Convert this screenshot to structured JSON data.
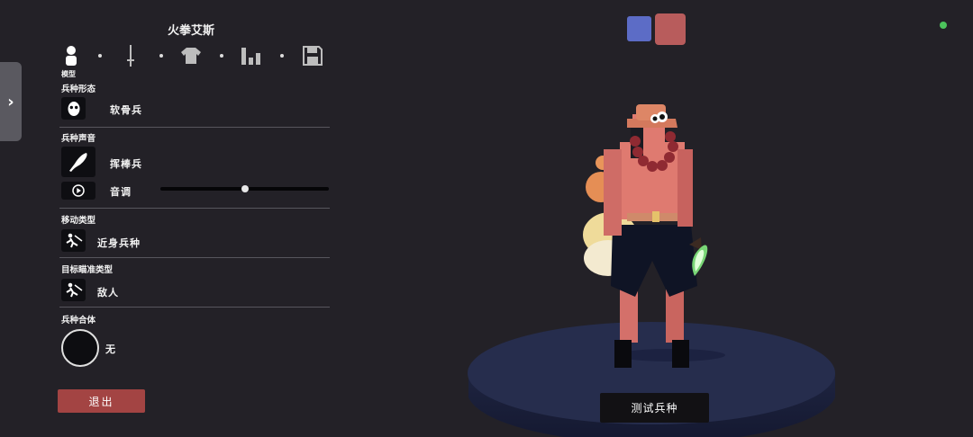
{
  "colors": {
    "background": "#232127",
    "team_blue": "#5c6cc6",
    "team_red": "#b85c5c",
    "exit_button": "#a34443",
    "status": "#4cc35c"
  },
  "unit_name": "火拳艾斯",
  "tabs": [
    {
      "icon": "person-icon",
      "label": "模型",
      "active": true
    },
    {
      "icon": "sword-icon",
      "label": ""
    },
    {
      "icon": "shirt-icon",
      "label": ""
    },
    {
      "icon": "bar-chart-icon",
      "label": ""
    },
    {
      "icon": "save-icon",
      "label": ""
    }
  ],
  "form": {
    "title": "兵种形态",
    "value": "软骨兵",
    "icon": "mask-icon"
  },
  "voice": {
    "title": "兵种声音",
    "value": "挥棒兵",
    "icon": "club-icon",
    "pitch_label": "音调",
    "pitch_level": 0.5,
    "play_icon": "play-icon"
  },
  "movement": {
    "title": "移动类型",
    "value": "近身兵种",
    "icon": "melee-icon"
  },
  "targeting": {
    "title": "目标瞄准类型",
    "value": "敌人",
    "icon": "target-icon"
  },
  "combine": {
    "title": "兵种合体",
    "value": "无"
  },
  "exit_label": "退出",
  "test_label": "测试兵种"
}
